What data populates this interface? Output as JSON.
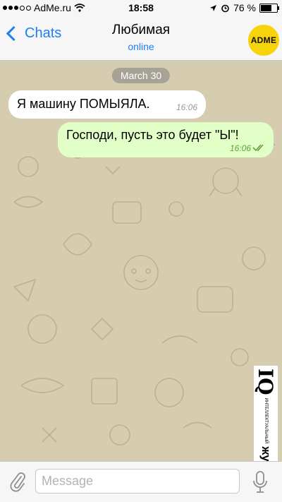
{
  "status_bar": {
    "carrier": "AdMe.ru",
    "time": "18:58",
    "battery_text": "76 %",
    "battery_level": 0.76,
    "signal_bars": 3,
    "icons": [
      "signal-icon",
      "wifi-icon",
      "location-arrow-icon",
      "alarm-icon",
      "battery-icon"
    ]
  },
  "nav": {
    "back_label": "Chats",
    "title": "Любимая",
    "subtitle": "online",
    "avatar_text": "ADME"
  },
  "chat": {
    "date_label": "March 30",
    "messages": [
      {
        "direction": "incoming",
        "text": "Я машину ПОМЫЯЛА.",
        "time": "16:06"
      },
      {
        "direction": "outgoing",
        "text": "Господи, пусть это будет \"Ы\"!",
        "time": "16:06",
        "status": "read"
      }
    ]
  },
  "watermark": {
    "big": "IQ",
    "small_line": "интеллектуальный",
    "mid": "журнал"
  },
  "input": {
    "placeholder": "Message"
  },
  "colors": {
    "accent": "#1f7ef5",
    "chat_background": "#d6cdb0",
    "outgoing_bubble": "#e1ffc7",
    "incoming_bubble": "#ffffff",
    "read_check": "#5ea33b",
    "avatar_bg": "#f6d30b"
  }
}
